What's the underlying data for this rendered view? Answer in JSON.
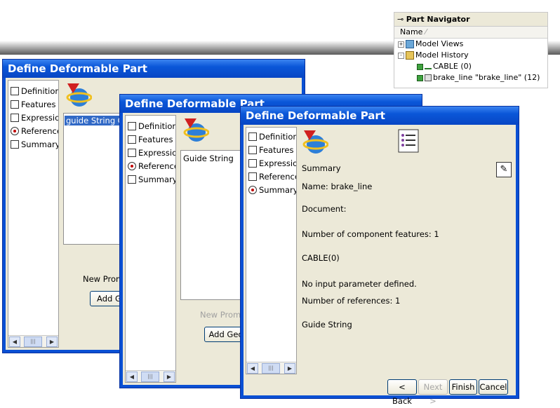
{
  "navigator": {
    "title": "Part Navigator",
    "column": "Name",
    "items": [
      {
        "expander": "+",
        "label": "Model Views"
      },
      {
        "expander": "-",
        "label": "Model History"
      },
      {
        "expander": "",
        "label": "CABLE (0)"
      },
      {
        "expander": "",
        "label": "brake_line \"brake_line\" (12)"
      }
    ]
  },
  "dialog1": {
    "title": "Define Deformable Part",
    "steps": [
      "Definition",
      "Features",
      "Expression",
      "Reference",
      "Summary"
    ],
    "selected_item": "guide String Ot",
    "prompt": "New Promp",
    "add_button": "Add Ge"
  },
  "dialog2": {
    "title": "Define Deformable Part",
    "steps": [
      "Definition",
      "Features",
      "Expression",
      "Reference",
      "Summary"
    ],
    "list_item": "Guide String",
    "prompt": "New Promp",
    "add_button": "Add Geo"
  },
  "dialog3": {
    "title": "Define Deformable Part",
    "steps": [
      "Definition",
      "Features",
      "Expression",
      "Reference",
      "Summary"
    ],
    "summary": {
      "heading": "Summary",
      "name": "Name: brake_line",
      "document": "Document:",
      "features_count": "Number of component features: 1",
      "feature": "CABLE(0)",
      "params": "No input parameter defined.",
      "refs_count": "Number of references: 1",
      "ref": "Guide String"
    },
    "buttons": {
      "back": "< Back",
      "next": "Next >",
      "finish": "Finish",
      "cancel": "Cancel"
    }
  }
}
